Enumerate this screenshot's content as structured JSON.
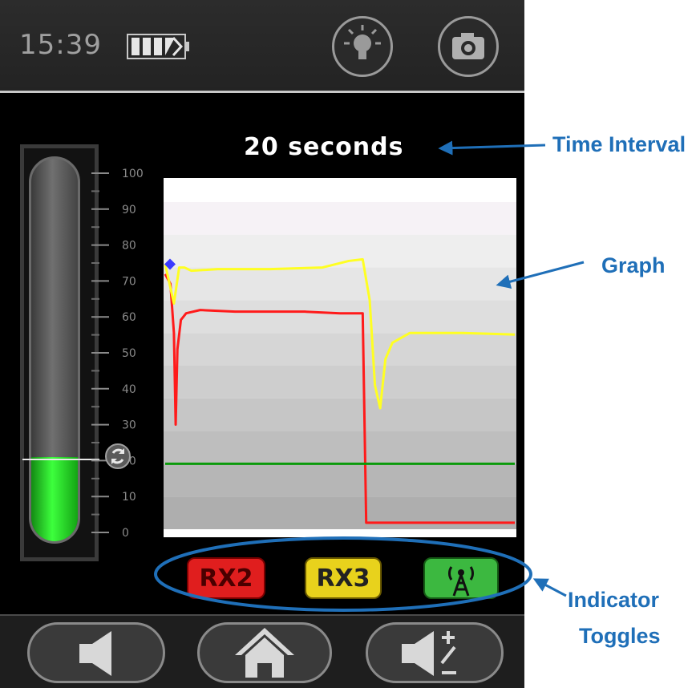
{
  "status_bar": {
    "time": "15:39",
    "battery_icon": "battery-icon",
    "light_button_icon": "lightbulb-icon",
    "camera_button_icon": "camera-icon"
  },
  "meter": {
    "level_fraction": 0.22,
    "marker_value": 22,
    "scale_labels": [
      "100",
      "90",
      "80",
      "70",
      "60",
      "50",
      "40",
      "30",
      "20",
      "10",
      "0"
    ],
    "reset_icon": "refresh-icon"
  },
  "graph": {
    "time_interval_label": "20 seconds",
    "colors": {
      "rx2": "#ff1a1a",
      "rx3": "#ffff22",
      "signal": "#0a9a0a",
      "marker": "#3a3aff"
    }
  },
  "chart_data": {
    "type": "line",
    "title": "",
    "xlabel": "",
    "ylabel": "",
    "xlim": [
      0,
      20
    ],
    "ylim": [
      0,
      100
    ],
    "series": [
      {
        "x": [
          0,
          0.3,
          0.5,
          0.6,
          0.7,
          0.9,
          1.2,
          2,
          4,
          6,
          8,
          10,
          11.1,
          11.3,
          11.5,
          12,
          20
        ],
        "values": [
          78,
          75,
          60,
          32,
          55,
          64,
          66,
          67,
          66.5,
          66.5,
          66.5,
          66,
          66,
          66,
          2,
          2,
          2
        ]
      },
      {
        "x": [
          0,
          0.5,
          0.8,
          1.1,
          1.5,
          3,
          6,
          9,
          10.5,
          11.3,
          11.7,
          12.0,
          12.3,
          12.6,
          13,
          14,
          17,
          20
        ],
        "values": [
          81,
          69,
          80,
          80,
          79,
          79.5,
          79.5,
          80,
          82,
          82.5,
          70,
          44,
          37,
          52,
          57,
          60,
          60,
          59.5
        ]
      },
      {
        "x": [
          0,
          20
        ],
        "values": [
          20,
          20
        ]
      }
    ]
  },
  "toggles": [
    {
      "label": "RX2",
      "bg": "#e01e1e",
      "fg": "#4a0000"
    },
    {
      "label": "RX3",
      "bg": "#e8d21c",
      "fg": "#222222"
    },
    {
      "label": "",
      "bg": "#3cb840",
      "icon": "antenna-icon"
    }
  ],
  "bottom_nav": {
    "mute_icon": "speaker-icon",
    "home_icon": "home-icon",
    "volume_icon": "volume-adjust-icon"
  },
  "annotations": {
    "time_interval": "Time Interval",
    "graph": "Graph",
    "indicator_toggles_line1": "Indicator",
    "indicator_toggles_line2": "Toggles"
  }
}
